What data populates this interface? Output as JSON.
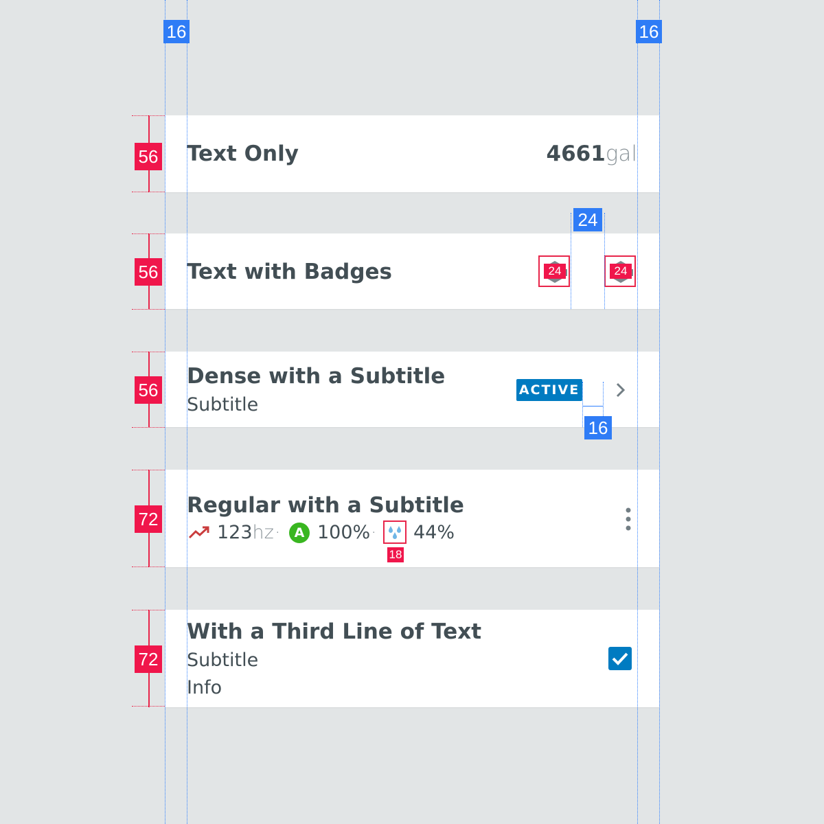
{
  "guides": {
    "margin_left": "16",
    "margin_right": "16"
  },
  "rows": [
    {
      "title": "Text Only",
      "value": "4661",
      "unit": "gal",
      "height_label": "56"
    },
    {
      "title": "Text with Badges",
      "height_label": "56",
      "badge_label": "24",
      "spacing_label": "24"
    },
    {
      "title": "Dense with a Subtitle",
      "subtitle": "Subtitle",
      "status": "ACTIVE",
      "height_label": "56",
      "spacing_label": "16"
    },
    {
      "title": "Regular with a Subtitle",
      "height_label": "72",
      "meta": {
        "trend_value": "123",
        "trend_unit": "hz",
        "grade_letter": "A",
        "grade_value": "100%",
        "humidity_value": "44%",
        "icon_size_label": "18",
        "separator": "·"
      }
    },
    {
      "title": "With a Third Line of Text",
      "subtitle": "Subtitle",
      "info": "Info",
      "height_label": "72",
      "checked": true
    }
  ],
  "colors": {
    "background": "#e2e5e6",
    "row_background": "#ffffff",
    "text": "#424e54",
    "accent_blue": "#007bc1",
    "guide_blue": "#2f80ff",
    "annotation_red": "#f0164b",
    "grade_green": "#39b620",
    "trend_red": "#ca3c3d",
    "drop_blue": "#6fb6e6"
  },
  "icons": [
    "hexagon-badge-icon",
    "chevron-right-icon",
    "trend-up-icon",
    "grade-a-icon",
    "water-drops-icon",
    "more-vertical-icon",
    "checkmark-icon"
  ]
}
